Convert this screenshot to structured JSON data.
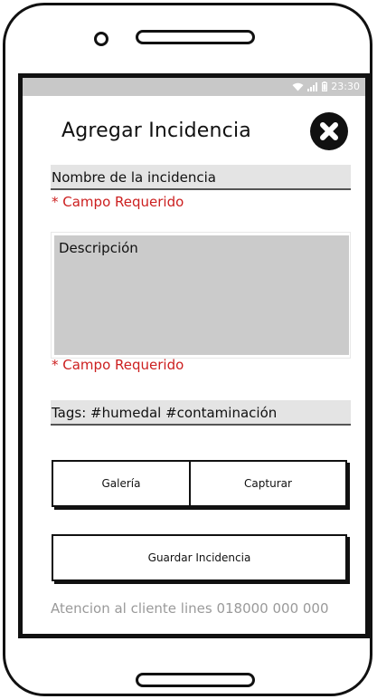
{
  "status_bar": {
    "time": "23:30"
  },
  "header": {
    "title": "Agregar Incidencia",
    "close_icon": "close-icon"
  },
  "form": {
    "name_field": {
      "value": "Nombre de la incidencia"
    },
    "name_error": "* Campo Requerido",
    "description_field": {
      "value": "Descripción"
    },
    "description_error": "* Campo Requerido",
    "tags_field": {
      "value": "Tags: #humedal #contaminación"
    }
  },
  "actions": {
    "gallery_label": "Galería",
    "capture_label": "Capturar",
    "save_label": "Guardar Incidencia"
  },
  "footer": {
    "support_text": "Atencion al cliente lines 018000 000 000"
  },
  "colors": {
    "error": "#cc1f1f",
    "status_bar": "#c8c8c8",
    "field_bg": "#e4e4e4",
    "textarea_bg": "#cbcbcb",
    "footer_text": "#9a9a9a"
  }
}
